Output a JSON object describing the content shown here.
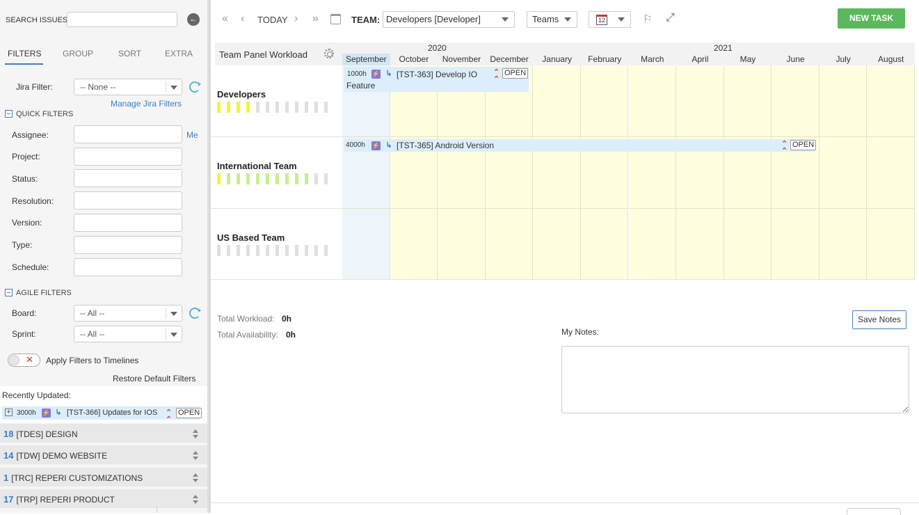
{
  "left": {
    "search_label": "SEARCH ISSUES:",
    "search_value": "",
    "tabs": [
      {
        "label": "FILTERS"
      },
      {
        "label": "GROUP"
      },
      {
        "label": "SORT"
      },
      {
        "label": "EXTRA"
      }
    ],
    "jira_filter": {
      "label": "Jira Filter:",
      "value": "-- None --",
      "manage_link": "Manage Jira Filters"
    },
    "quick_filters": {
      "title": "QUICK FILTERS",
      "me_link": "Me",
      "fields": [
        {
          "label": "Assignee:",
          "value": ""
        },
        {
          "label": "Project:",
          "value": ""
        },
        {
          "label": "Status:",
          "value": ""
        },
        {
          "label": "Resolution:",
          "value": ""
        },
        {
          "label": "Version:",
          "value": ""
        },
        {
          "label": "Type:",
          "value": ""
        },
        {
          "label": "Schedule:",
          "value": ""
        }
      ]
    },
    "agile_filters": {
      "title": "AGILE FILTERS",
      "board": {
        "label": "Board:",
        "value": "-- All --"
      },
      "sprint": {
        "label": "Sprint:",
        "value": "-- All --"
      }
    },
    "apply_filters_label": "Apply Filters to Timelines",
    "apply_filters_on": false,
    "restore_label": "Restore Default Filters",
    "recently_updated": {
      "label": "Recently Updated:",
      "issue": {
        "hours": "3000h",
        "title": "[TST-366] Updates for IOS",
        "status": "OPEN",
        "type_icon": "epic-icon",
        "priority": "high"
      }
    },
    "projects": [
      {
        "count": "18",
        "name": "[TDES] DESIGN"
      },
      {
        "count": "14",
        "name": "[TDW] DEMO WEBSITE"
      },
      {
        "count": "1",
        "name": "[TRC] REPERI CUSTOMIZATIONS"
      },
      {
        "count": "17",
        "name": "[TRP] REPERI PRODUCT"
      }
    ]
  },
  "toolbar": {
    "today_label": "TODAY",
    "team_label": "TEAM:",
    "team_value": "Developers [Developer]",
    "view_value": "Teams",
    "calendar_value": "12",
    "new_task_label": "NEW TASK"
  },
  "timeline": {
    "panel_title": "Team Panel Workload",
    "years": [
      {
        "label": "2020"
      },
      {
        "label": "2021"
      }
    ],
    "months": [
      "September",
      "October",
      "November",
      "December",
      "January",
      "February",
      "March",
      "April",
      "May",
      "June",
      "July",
      "August"
    ],
    "current_month_index": 0,
    "teams": [
      {
        "name": "Developers",
        "workload": [
          "y",
          "y",
          "y",
          "y",
          "n",
          "n",
          "n",
          "n",
          "n",
          "n",
          "n",
          "n"
        ],
        "task": {
          "hours": "1000h",
          "title": "[TST-363] Develop IO",
          "title_line2": "Feature",
          "status": "OPEN",
          "start_month": 0,
          "span_months": 4
        }
      },
      {
        "name": "International Team",
        "workload": [
          "y",
          "g",
          "g",
          "g",
          "g",
          "g",
          "g",
          "g",
          "g",
          "g",
          "n",
          "n"
        ],
        "task": {
          "hours": "4000h",
          "title": "[TST-365] Android Version",
          "title_line2": "",
          "status": "OPEN",
          "start_month": 0,
          "span_months": 10
        }
      },
      {
        "name": "US Based Team",
        "workload": [
          "n",
          "n",
          "n",
          "n",
          "n",
          "n",
          "n",
          "n",
          "n",
          "n",
          "n",
          "n"
        ],
        "task": null
      }
    ]
  },
  "summary": {
    "total_workload_label": "Total Workload:",
    "total_workload_value": "0h",
    "total_availability_label": "Total Availability:",
    "total_availability_value": "0h"
  },
  "notes": {
    "label": "My Notes:",
    "value": "",
    "save_label": "Save Notes"
  },
  "colors": {
    "accent": "#3b7dc4",
    "new_task": "#5cb85c",
    "grid_fill": "#ffffe0",
    "current_month": "#eef5fa",
    "task_bar": "#dceefa",
    "workload_high": "#f6f33a",
    "workload_ok": "#c6f08a",
    "workload_none": "#e0e0e0",
    "priority": "#d0442a",
    "epic": "#8777d9"
  }
}
